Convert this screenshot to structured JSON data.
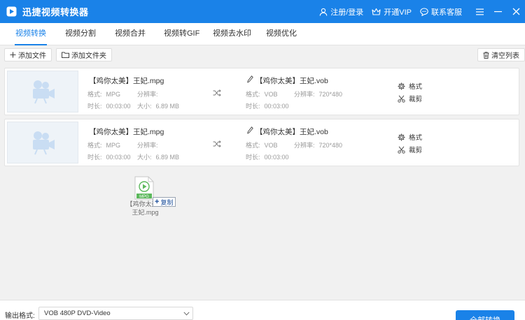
{
  "app": {
    "title": "迅捷视频转换器",
    "links": {
      "login": "注册/登录",
      "vip": "开通VIP",
      "support": "联系客服"
    }
  },
  "tabs": [
    {
      "label": "视频转换",
      "active": true
    },
    {
      "label": "视频分割",
      "active": false
    },
    {
      "label": "视频合并",
      "active": false
    },
    {
      "label": "视频转GIF",
      "active": false
    },
    {
      "label": "视频去水印",
      "active": false
    },
    {
      "label": "视频优化",
      "active": false
    }
  ],
  "toolbar": {
    "add_file": "添加文件",
    "add_folder": "添加文件夹",
    "clear_list": "清空列表"
  },
  "files": [
    {
      "src_name": "【鸡你太美】王妃.mpg",
      "src_format_label": "格式:",
      "src_format": "MPG",
      "src_res_label": "分辨率:",
      "src_res": "",
      "src_duration_label": "时长:",
      "src_duration": "00:03:00",
      "src_size_label": "大小:",
      "src_size": "6.89 MB",
      "dst_name": "【鸡你太美】王妃.vob",
      "dst_format_label": "格式:",
      "dst_format": "VOB",
      "dst_res_label": "分辨率:",
      "dst_res": "720*480",
      "dst_duration_label": "时长:",
      "dst_duration": "00:03:00",
      "action_format": "格式",
      "action_cut": "裁剪"
    },
    {
      "src_name": "【鸡你太美】王妃.mpg",
      "src_format_label": "格式:",
      "src_format": "MPG",
      "src_res_label": "分辨率:",
      "src_res": "",
      "src_duration_label": "时长:",
      "src_duration": "00:03:00",
      "src_size_label": "大小:",
      "src_size": "6.89 MB",
      "dst_name": "【鸡你太美】王妃.vob",
      "dst_format_label": "格式:",
      "dst_format": "VOB",
      "dst_res_label": "分辨率:",
      "dst_res": "720*480",
      "dst_duration_label": "时长:",
      "dst_duration": "00:03:00",
      "action_format": "格式",
      "action_cut": "裁剪"
    }
  ],
  "drag": {
    "badge": "MPG",
    "name_line1": "【鸡你太美】",
    "name_line2": "王妃.mpg",
    "tip_plus": "+",
    "tip_text": "复制"
  },
  "bottom": {
    "output_label": "输出格式:",
    "output_value": "VOB  480P DVD-Video",
    "convert_label": "全部转换"
  },
  "colors": {
    "accent": "#1a82e8",
    "thumb_bg": "#eef3f8",
    "thumb_icon": "#c9ddf3",
    "ghost_green": "#5cb85c"
  }
}
